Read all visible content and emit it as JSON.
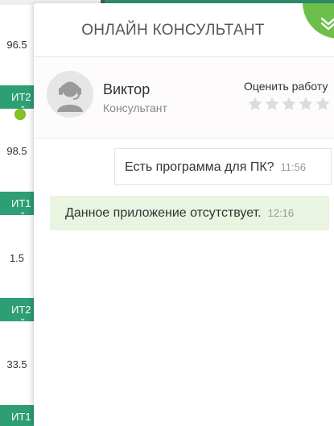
{
  "background": {
    "values": [
      "96.5",
      "98.5",
      "1.5",
      "33.5"
    ],
    "badges": [
      "ИТ2",
      "ИТ1",
      "ИТ2",
      "ИТ1"
    ]
  },
  "chat": {
    "title": "ОНЛАЙН КОНСУЛЬТАНТ",
    "collapse_icon": "double-chevron-down-icon",
    "agent": {
      "name": "Виктор",
      "role": "Консультант",
      "status": "online",
      "avatar_icon": "headset-operator-icon"
    },
    "rating": {
      "label": "Оценить работу",
      "max_stars": 5,
      "value": 0
    },
    "messages": [
      {
        "direction": "out",
        "text": "Есть программа для ПК?",
        "time": "11:56"
      },
      {
        "direction": "in",
        "text": "Данное приложение отсутствует.",
        "time": "12:16"
      }
    ]
  },
  "colors": {
    "accent_green": "#6cc04a",
    "badge_green": "#2e9e74",
    "online_dot": "#84c225",
    "incoming_bubble": "#e9f4e1",
    "star_inactive": "#dcdcdc"
  }
}
